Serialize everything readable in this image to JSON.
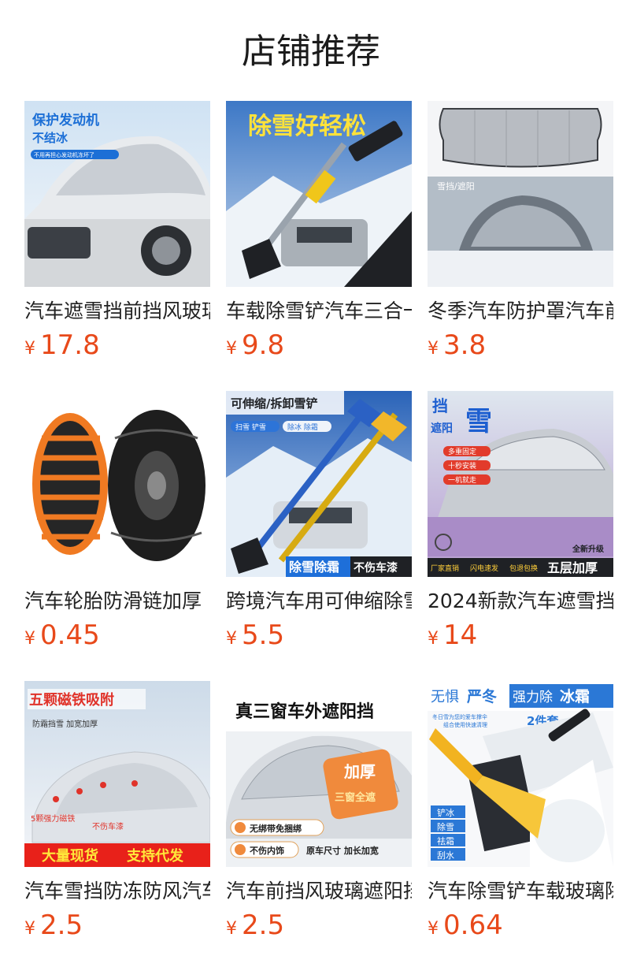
{
  "header": {
    "title": "店铺推荐"
  },
  "currency": "¥",
  "products": [
    {
      "name": "汽车遮雪挡前挡风玻璃",
      "price": "17.8",
      "image_text": [
        "保护发动机",
        "不结冰",
        "不用再担心发动机冻坏了"
      ]
    },
    {
      "name": "车载除雪铲汽车三合一",
      "price": "9.8",
      "image_text": [
        "除雪好轻松"
      ]
    },
    {
      "name": "冬季汽车防护罩汽车前",
      "price": "3.8",
      "image_text": [
        "雪挡/遮阳"
      ]
    },
    {
      "name": "汽车轮胎防滑链加厚",
      "price": "0.45",
      "image_text": []
    },
    {
      "name": "跨境汽车用可伸缩除雪",
      "price": "5.5",
      "image_text": [
        "可伸缩/拆卸雪铲",
        "扫雪 铲雪",
        "除冰 除霜",
        "除雪除霜",
        "不伤车漆"
      ]
    },
    {
      "name": "2024新款汽车遮雪挡",
      "price": "14",
      "image_text": [
        "挡",
        "遮阳",
        "雪",
        "多重固定",
        "十秒安装",
        "一机就走",
        "全新升级",
        "厂家直销",
        "闪电速发",
        "包退包换",
        "五层加厚"
      ]
    },
    {
      "name": "汽车雪挡防冻防风汽车",
      "price": "2.5",
      "image_text": [
        "五颗磁铁吸附",
        "防霜挡雪 加宽加厚",
        "5颗强力磁铁",
        "不伤车漆",
        "大量现货",
        "支持代发"
      ]
    },
    {
      "name": "汽车前挡风玻璃遮阳挡",
      "price": "2.5",
      "image_text": [
        "真三窗车外遮阳挡",
        "加厚",
        "三窗全遮",
        "无绑带免捆绑",
        "不伤内饰",
        "原车尺寸 加长加宽"
      ]
    },
    {
      "name": "汽车除雪铲车载玻璃除",
      "price": "0.64",
      "image_text": [
        "无惧",
        "严冬",
        "强力除",
        "冰霜",
        "2件套",
        "冬日雪为您的爱车撑伞",
        "组合使用快速清理",
        "铲冰",
        "除雪",
        "祛霜",
        "刮水"
      ]
    }
  ],
  "colors": {
    "price": "#e8491a",
    "title": "#1b1b1b",
    "text": "#222222"
  }
}
